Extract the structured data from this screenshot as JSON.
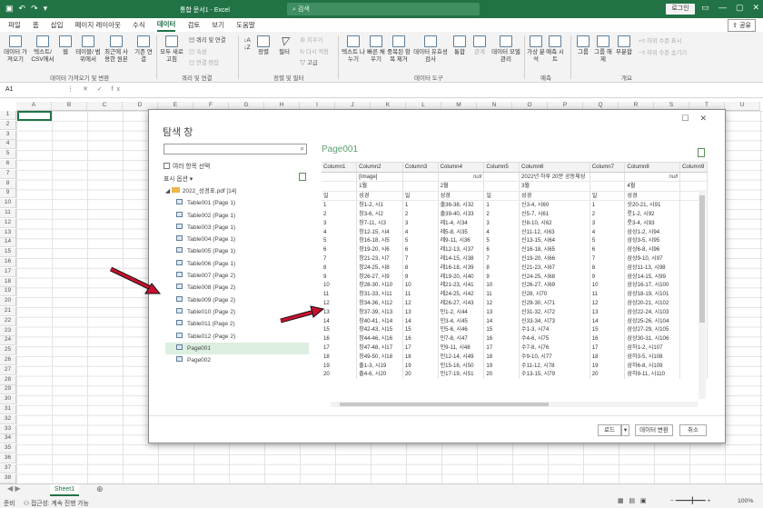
{
  "app": {
    "title": "통합 문서1 - Excel",
    "search_placeholder": "검색",
    "login": "로그인",
    "share": "공유"
  },
  "tabs": [
    "파일",
    "홈",
    "삽입",
    "페이지 레이아웃",
    "수식",
    "데이터",
    "검토",
    "보기",
    "도움말"
  ],
  "active_tab": "데이터",
  "ribbon": {
    "get_data": "데이터 가져오기",
    "text_csv": "텍스트/ CSV에서",
    "web": "웹",
    "table_range": "테이블/ 범위에서",
    "recent_sources": "최근에 사 용한 원본",
    "existing": "기존 연결",
    "refresh_all": "모두 새로 고침",
    "queries_conn": "쿼리 및 연결",
    "properties": "속성",
    "edit_links": "연결 편집",
    "sort": "정렬",
    "filter": "필터",
    "clear": "지우기",
    "reapply": "다시 적용",
    "advanced": "고급",
    "text_to_cols": "텍스트 나누기",
    "flash_fill": "빠른 채우기",
    "remove_dup": "중복된 항목 제거",
    "validation": "데이터 유효성 검사",
    "consolidate": "통합",
    "relations": "관계",
    "data_model": "데이터 모델 관리",
    "whatif": "가상 분석",
    "forecast": "예측 시트",
    "group": "그룹",
    "ungroup": "그룹 해제",
    "subtotal": "부분합",
    "show_detail": "하위 수준 표시",
    "hide_detail": "하위 수준 숨기기",
    "groups": [
      "데이터 가져오기 및 변환",
      "쿼리 및 연결",
      "정렬 및 필터",
      "데이터 도구",
      "예측",
      "개요"
    ]
  },
  "formula_bar": {
    "name_box": "A1",
    "fx": "fx"
  },
  "columns": [
    "A",
    "B",
    "C",
    "D",
    "E",
    "F",
    "G",
    "H",
    "I",
    "J",
    "K",
    "L",
    "M",
    "N",
    "O",
    "P",
    "Q",
    "R",
    "S",
    "T",
    "U"
  ],
  "rows": [
    "1",
    "2",
    "3",
    "4",
    "5",
    "6",
    "7",
    "8",
    "9",
    "10",
    "11",
    "12",
    "13",
    "14",
    "15",
    "16",
    "17",
    "18",
    "19",
    "20",
    "21",
    "22",
    "23",
    "24",
    "25",
    "26",
    "27",
    "28",
    "29",
    "30",
    "31",
    "32",
    "33",
    "34",
    "35",
    "36",
    "37",
    "38"
  ],
  "sheet_tab": "Sheet1",
  "status": {
    "ready": "준비",
    "accessibility": "접근성: 계속 진행 가능",
    "zoom": "100%"
  },
  "navigator": {
    "title": "탐색 창",
    "multi_select": "여러 항목 선택",
    "display_options": "표시 옵션",
    "folder": "2022_성경표.pdf [14]",
    "items": [
      "Table001 (Page 1)",
      "Table002 (Page 1)",
      "Table003 (Page 1)",
      "Table004 (Page 1)",
      "Table005 (Page 1)",
      "Table006 (Page 1)",
      "Table007 (Page 2)",
      "Table008 (Page 2)",
      "Table009 (Page 2)",
      "Table010 (Page 2)",
      "Table011 (Page 2)",
      "Table012 (Page 2)",
      "Page001",
      "Page002"
    ],
    "selected": "Page001",
    "preview_title": "Page001",
    "headers": [
      "Column1",
      "Column2",
      "Column3",
      "Column4",
      "Column5",
      "Column6",
      "Column7",
      "Column8",
      "Column9"
    ],
    "row1": [
      "",
      "[Image]",
      "",
      "null",
      "",
      "2022년 하루 20분 공동체성",
      "",
      "null",
      ""
    ],
    "row2": [
      "",
      "1월",
      "",
      "2월",
      "",
      "3월",
      "",
      "4월",
      ""
    ],
    "row3": [
      "일",
      "성경",
      "일",
      "성경",
      "일",
      "성경",
      "일",
      "성경",
      ""
    ],
    "data": [
      [
        "1",
        "창1-2, 시1",
        "1",
        "출36-38, 시32",
        "1",
        "신3-4, 시60",
        "1",
        "삿20-21, 시91"
      ],
      [
        "2",
        "창3-6, 시2",
        "2",
        "출39-40, 시33",
        "2",
        "신5-7, 시61",
        "2",
        "룻1-2, 시92"
      ],
      [
        "3",
        "창7-11, 시3",
        "3",
        "레1-4, 시34",
        "3",
        "신8-10, 시62",
        "3",
        "룻3-4, 시93"
      ],
      [
        "4",
        "창12-15, 시4",
        "4",
        "레5-8, 시35",
        "4",
        "신11-12, 시63",
        "4",
        "삼상1-2, 시94"
      ],
      [
        "5",
        "창16-18, 시5",
        "5",
        "레9-11, 시36",
        "5",
        "신13-15, 시64",
        "5",
        "삼상3-5, 시95"
      ],
      [
        "6",
        "창19-20, 시6",
        "6",
        "레12-13, 시37",
        "6",
        "신16-18, 시65",
        "6",
        "삼상6-8, 시96"
      ],
      [
        "7",
        "창21-23, 시7",
        "7",
        "레14-15, 시38",
        "7",
        "신19-20, 시66",
        "7",
        "삼상9-10, 시97"
      ],
      [
        "8",
        "창24-25, 시8",
        "8",
        "레16-18, 시39",
        "8",
        "신21-23, 시67",
        "8",
        "삼상11-13, 시98"
      ],
      [
        "9",
        "창26-27, 시9",
        "9",
        "레19-20, 시40",
        "9",
        "신24-25, 시68",
        "9",
        "삼상14-15, 시99"
      ],
      [
        "10",
        "창28-30, 시10",
        "10",
        "레21-23, 시41",
        "10",
        "신26-27, 시69",
        "10",
        "삼상16-17, 시100"
      ],
      [
        "11",
        "창31-33, 시11",
        "11",
        "레24-25, 시42",
        "11",
        "신28, 시70",
        "11",
        "삼상18-19, 시101"
      ],
      [
        "12",
        "창34-36, 시12",
        "12",
        "레26-27, 시43",
        "12",
        "신29-30, 시71",
        "12",
        "삼상20-21, 시102"
      ],
      [
        "13",
        "창37-39, 시13",
        "13",
        "민1-2, 시44",
        "13",
        "신31-32, 시72",
        "13",
        "삼상22-24, 시103"
      ],
      [
        "14",
        "창40-41, 시14",
        "14",
        "민3-4, 시45",
        "14",
        "신33-34, 시73",
        "14",
        "삼상25-26, 시104"
      ],
      [
        "15",
        "창42-43, 시15",
        "15",
        "민5-6, 시46",
        "15",
        "수1-3, 시74",
        "15",
        "삼상27-29, 시105"
      ],
      [
        "16",
        "창44-46, 시16",
        "16",
        "민7-8, 시47",
        "16",
        "수4-6, 시75",
        "16",
        "삼상30-31, 시106"
      ],
      [
        "17",
        "창47-48, 시17",
        "17",
        "민9-11, 시48",
        "17",
        "수7-8, 시76",
        "17",
        "삼하1-2, 시107"
      ],
      [
        "18",
        "창49-50, 시18",
        "18",
        "민12-14, 시49",
        "18",
        "수9-10, 시77",
        "18",
        "삼하3-5, 시108"
      ],
      [
        "19",
        "출1-3, 시19",
        "19",
        "민15-16, 시50",
        "19",
        "수11-12, 시78",
        "19",
        "삼하6-8, 시109"
      ],
      [
        "20",
        "출4-6, 시20",
        "20",
        "민17-19, 시51",
        "20",
        "수13-15, 시79",
        "20",
        "삼하9-11, 시110"
      ]
    ],
    "load": "로드",
    "transform": "데이터 변환",
    "cancel": "취소"
  }
}
